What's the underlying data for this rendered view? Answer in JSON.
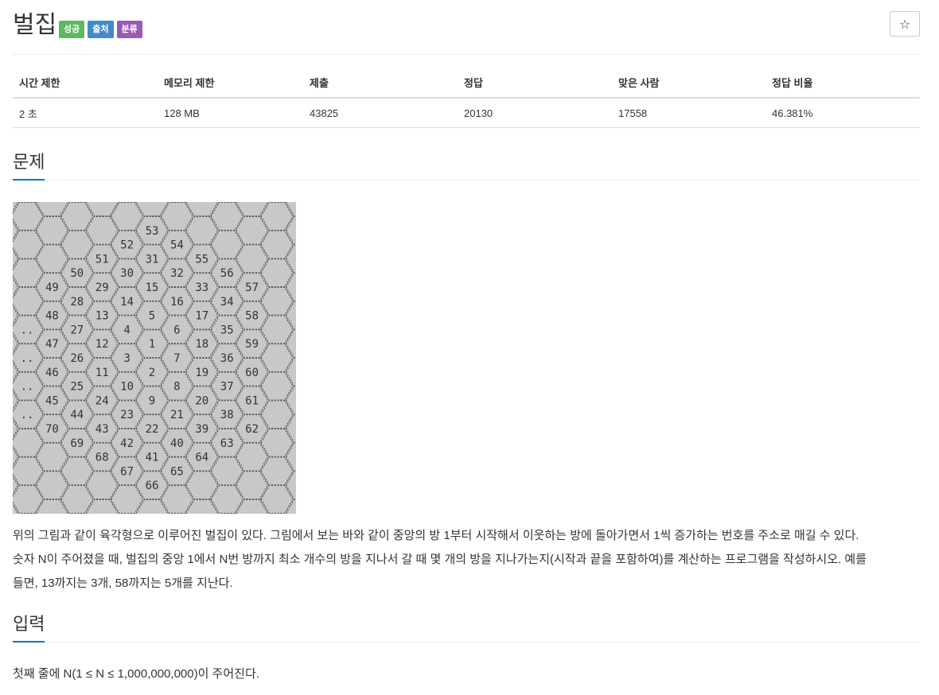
{
  "problem": {
    "title": "벌집",
    "labels": [
      {
        "text": "성공",
        "color": "#5cb85c"
      },
      {
        "text": "출처",
        "color": "#428bca"
      },
      {
        "text": "분류",
        "color": "#9b59b6"
      }
    ],
    "star_icon": "☆"
  },
  "info": {
    "headers": [
      "시간 제한",
      "메모리 제한",
      "제출",
      "정답",
      "맞은 사람",
      "정답 비율"
    ],
    "values": [
      "2 초",
      "128 MB",
      "43825",
      "20130",
      "17558",
      "46.381%"
    ]
  },
  "sections": {
    "problem": "문제",
    "input": "입력"
  },
  "figure": {
    "numbers": [
      [
        "53",
        5,
        1
      ],
      [
        "52",
        4,
        2
      ],
      [
        "54",
        6,
        2
      ],
      [
        "51",
        3,
        3
      ],
      [
        "31",
        5,
        3
      ],
      [
        "55",
        7,
        3
      ],
      [
        "50",
        2,
        4
      ],
      [
        "30",
        4,
        4
      ],
      [
        "32",
        6,
        4
      ],
      [
        "56",
        8,
        4
      ],
      [
        "49",
        1,
        5
      ],
      [
        "29",
        3,
        5
      ],
      [
        "15",
        5,
        5
      ],
      [
        "33",
        7,
        5
      ],
      [
        "57",
        9,
        5
      ],
      [
        "28",
        2,
        6
      ],
      [
        "14",
        4,
        6
      ],
      [
        "16",
        6,
        6
      ],
      [
        "34",
        8,
        6
      ],
      [
        "48",
        1,
        7
      ],
      [
        "13",
        3,
        7
      ],
      [
        "5",
        5,
        7
      ],
      [
        "17",
        7,
        7
      ],
      [
        "58",
        9,
        7
      ],
      [
        "..",
        0,
        8
      ],
      [
        "27",
        2,
        8
      ],
      [
        "4",
        4,
        8
      ],
      [
        "6",
        6,
        8
      ],
      [
        "35",
        8,
        8
      ],
      [
        "47",
        1,
        9
      ],
      [
        "12",
        3,
        9
      ],
      [
        "1",
        5,
        9
      ],
      [
        "18",
        7,
        9
      ],
      [
        "59",
        9,
        9
      ],
      [
        "..",
        0,
        10
      ],
      [
        "26",
        2,
        10
      ],
      [
        "3",
        4,
        10
      ],
      [
        "7",
        6,
        10
      ],
      [
        "36",
        8,
        10
      ],
      [
        "46",
        1,
        11
      ],
      [
        "11",
        3,
        11
      ],
      [
        "2",
        5,
        11
      ],
      [
        "19",
        7,
        11
      ],
      [
        "60",
        9,
        11
      ],
      [
        "..",
        0,
        12
      ],
      [
        "25",
        2,
        12
      ],
      [
        "10",
        4,
        12
      ],
      [
        "8",
        6,
        12
      ],
      [
        "37",
        8,
        12
      ],
      [
        "45",
        1,
        13
      ],
      [
        "24",
        3,
        13
      ],
      [
        "9",
        5,
        13
      ],
      [
        "20",
        7,
        13
      ],
      [
        "61",
        9,
        13
      ],
      [
        "..",
        0,
        14
      ],
      [
        "44",
        2,
        14
      ],
      [
        "23",
        4,
        14
      ],
      [
        "21",
        6,
        14
      ],
      [
        "38",
        8,
        14
      ],
      [
        "70",
        1,
        15
      ],
      [
        "43",
        3,
        15
      ],
      [
        "22",
        5,
        15
      ],
      [
        "39",
        7,
        15
      ],
      [
        "62",
        9,
        15
      ],
      [
        "69",
        2,
        16
      ],
      [
        "42",
        4,
        16
      ],
      [
        "40",
        6,
        16
      ],
      [
        "63",
        8,
        16
      ],
      [
        "68",
        3,
        17
      ],
      [
        "41",
        5,
        17
      ],
      [
        "64",
        7,
        17
      ],
      [
        "67",
        4,
        18
      ],
      [
        "65",
        6,
        18
      ],
      [
        "66",
        5,
        19
      ]
    ]
  },
  "description": [
    "위의 그림과 같이 육각형으로 이루어진 벌집이 있다. 그림에서 보는 바와 같이 중앙의 방 1부터 시작해서 이웃하는 방에 돌아가면서 1씩 증가하는 번호를 주소로 매길 수 있다.",
    "숫자 N이 주어졌을 때, 벌집의 중앙 1에서 N번 방까지 최소 개수의 방을 지나서 갈 때 몇 개의 방을 지나가는지(시작과 끝을 포함하여)를 계산하는 프로그램을 작성하시오. 예를",
    "들면, 13까지는 3개, 58까지는 5개를 지난다."
  ],
  "input_text": "첫째 줄에 N(1 ≤ N ≤ 1,000,000,000)이 주어진다."
}
